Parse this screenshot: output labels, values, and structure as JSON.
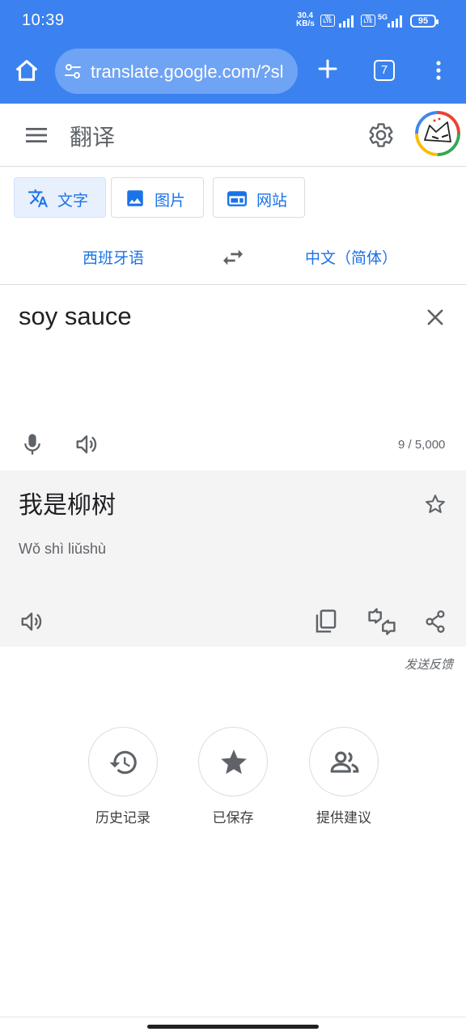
{
  "status_bar": {
    "time": "10:39",
    "net_speed_value": "30.4",
    "net_speed_unit": "KB/s",
    "lte_label_top": "Vo",
    "lte_label_bottom": "LTE",
    "network_5g": "5G",
    "battery": "95"
  },
  "browser": {
    "url": "translate.google.com/?sl",
    "tab_count": "7"
  },
  "header": {
    "title": "翻译"
  },
  "modes": {
    "text": "文字",
    "images": "图片",
    "website": "网站"
  },
  "languages": {
    "source": "西班牙语",
    "target": "中文（简体）"
  },
  "source": {
    "text": "soy sauce",
    "char_count": "9 / 5,000"
  },
  "result": {
    "text": "我是柳树",
    "pinyin": "Wǒ shì liǔshù"
  },
  "send_feedback": "发送反馈",
  "actions": {
    "history": "历史记录",
    "saved": "已保存",
    "contribute": "提供建议"
  },
  "colors": {
    "browser_bar": "#3b82f0",
    "accent": "#1a73e8",
    "result_bg": "#f4f4f4"
  }
}
